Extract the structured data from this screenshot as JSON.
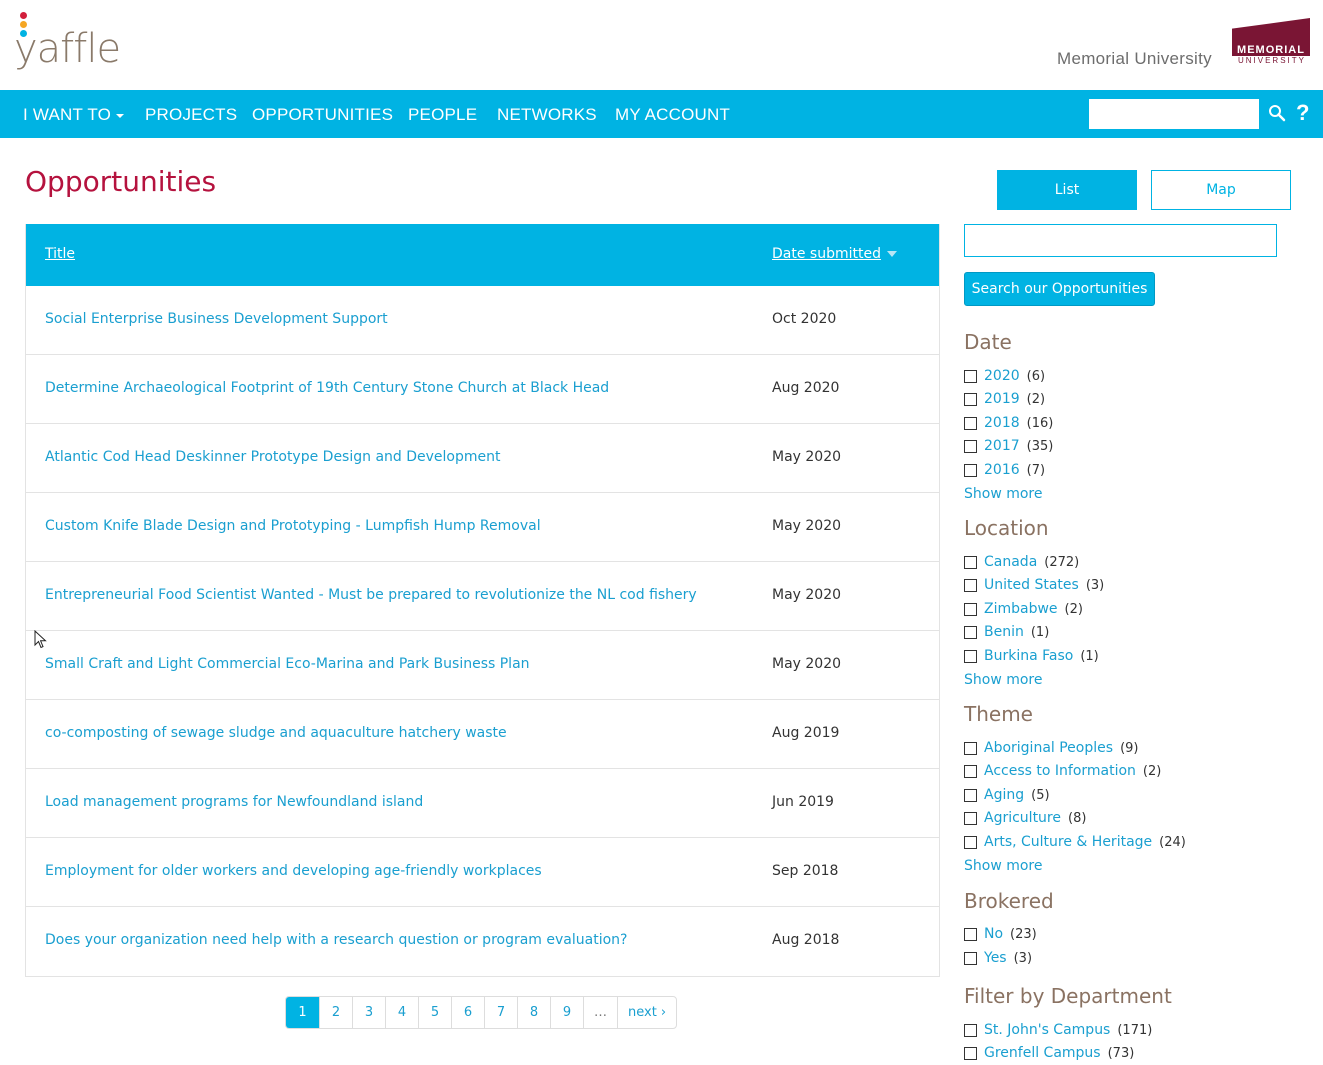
{
  "header": {
    "logo_text": "yaffle",
    "university_name": "Memorial University",
    "mun_logo_main": "MEMORIAL",
    "mun_logo_sub": "UNIVERSITY",
    "logo_dot_colors": [
      "#d21f3c",
      "#f5a623",
      "#00b3e3"
    ]
  },
  "nav": {
    "items": [
      {
        "label": "I WANT TO",
        "has_caret": true
      },
      {
        "label": "PROJECTS"
      },
      {
        "label": "OPPORTUNITIES"
      },
      {
        "label": "PEOPLE"
      },
      {
        "label": "NETWORKS"
      },
      {
        "label": "MY ACCOUNT"
      }
    ],
    "search_placeholder": "",
    "help_label": "?"
  },
  "page_title": "Opportunities",
  "table": {
    "columns": {
      "title": "Title",
      "date": "Date submitted"
    },
    "rows": [
      {
        "title": "Social Enterprise Business Development Support",
        "date": "Oct 2020"
      },
      {
        "title": "Determine Archaeological Footprint of 19th Century Stone Church at Black Head",
        "date": "Aug 2020"
      },
      {
        "title": "Atlantic Cod Head Deskinner Prototype Design and Development",
        "date": "May 2020"
      },
      {
        "title": "Custom Knife Blade Design and Prototyping - Lumpfish Hump Removal",
        "date": "May 2020"
      },
      {
        "title": "Entrepreneurial Food Scientist Wanted - Must be prepared to revolutionize the NL cod fishery",
        "date": "May 2020"
      },
      {
        "title": "Small Craft and Light Commercial Eco-Marina and Park Business Plan",
        "date": "May 2020"
      },
      {
        "title": "co-composting of sewage sludge and aquaculture hatchery waste",
        "date": "Aug 2019"
      },
      {
        "title": "Load management programs for Newfoundland island",
        "date": "Jun 2019"
      },
      {
        "title": "Employment for older workers and developing age-friendly workplaces",
        "date": "Sep 2018"
      },
      {
        "title": "Does your organization need help with a research question or program evaluation?",
        "date": "Aug 2018"
      }
    ]
  },
  "pagination": {
    "pages": [
      "1",
      "2",
      "3",
      "4",
      "5",
      "6",
      "7",
      "8",
      "9",
      "…",
      "next ›"
    ],
    "active": "1"
  },
  "sidebar": {
    "view_list": "List",
    "view_map": "Map",
    "search_value": "",
    "search_button": "Search our Opportunities",
    "show_more": "Show more",
    "facets": {
      "date": {
        "title": "Date",
        "items": [
          {
            "label": "2020",
            "count": "(6)"
          },
          {
            "label": "2019",
            "count": "(2)"
          },
          {
            "label": "2018",
            "count": "(16)"
          },
          {
            "label": "2017",
            "count": "(35)"
          },
          {
            "label": "2016",
            "count": "(7)"
          }
        ]
      },
      "location": {
        "title": "Location",
        "items": [
          {
            "label": "Canada",
            "count": "(272)"
          },
          {
            "label": "United States",
            "count": "(3)"
          },
          {
            "label": "Zimbabwe",
            "count": "(2)"
          },
          {
            "label": "Benin",
            "count": "(1)"
          },
          {
            "label": "Burkina Faso",
            "count": "(1)"
          }
        ]
      },
      "theme": {
        "title": "Theme",
        "items": [
          {
            "label": "Aboriginal Peoples",
            "count": "(9)"
          },
          {
            "label": "Access to Information",
            "count": "(2)"
          },
          {
            "label": "Aging",
            "count": "(5)"
          },
          {
            "label": "Agriculture",
            "count": "(8)"
          },
          {
            "label": "Arts, Culture & Heritage",
            "count": "(24)"
          }
        ]
      },
      "brokered": {
        "title": "Brokered",
        "items": [
          {
            "label": "No",
            "count": "(23)"
          },
          {
            "label": "Yes",
            "count": "(3)"
          }
        ]
      },
      "department": {
        "title": "Filter by Department",
        "items": [
          {
            "label": "St. John's Campus",
            "count": "(171)"
          },
          {
            "label": "Grenfell Campus",
            "count": "(73)"
          }
        ]
      }
    }
  }
}
